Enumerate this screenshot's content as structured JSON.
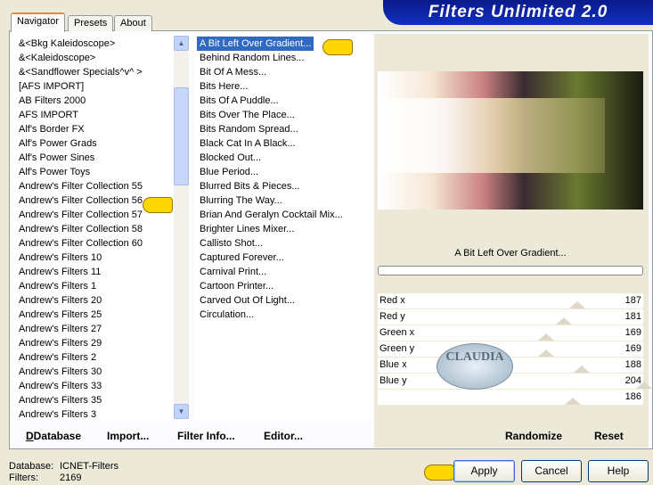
{
  "banner": {
    "title": "Filters Unlimited 2.0"
  },
  "tabs": [
    {
      "label": "Navigator"
    },
    {
      "label": "Presets"
    },
    {
      "label": "About"
    }
  ],
  "categories": [
    "&<Bkg Kaleidoscope>",
    "&<Kaleidoscope>",
    "&<Sandflower Specials^v^ >",
    "[AFS IMPORT]",
    "AB Filters 2000",
    "AFS IMPORT",
    "Alf's Border FX",
    "Alf's Power Grads",
    "Alf's Power Sines",
    "Alf's Power Toys",
    "Andrew's Filter Collection 55",
    "Andrew's Filter Collection 56",
    "Andrew's Filter Collection 57",
    "Andrew's Filter Collection 58",
    "Andrew's Filter Collection 60",
    "Andrew's Filters 10",
    "Andrew's Filters 11",
    "Andrew's Filters 1",
    "Andrew's Filters 20",
    "Andrew's Filters 25",
    "Andrew's Filters 27",
    "Andrew's Filters 29",
    "Andrew's Filters 2",
    "Andrew's Filters 30",
    "Andrew's Filters 33",
    "Andrew's Filters 35",
    "Andrew's Filters 3"
  ],
  "selected_category": "Andrew's Filter Collection 56",
  "filters": [
    "A Bit Left Over Gradient...",
    "Behind Random Lines...",
    "Bit Of A Mess...",
    "Bits Here...",
    "Bits Of A Puddle...",
    "Bits Over The Place...",
    "Bits Random Spread...",
    "Black Cat In A Black...",
    "Blocked Out...",
    "Blue Period...",
    "Blurred Bits & Pieces...",
    "Blurring The Way...",
    "Brian And Geralyn Cocktail Mix...",
    "Brighter Lines Mixer...",
    "Callisto Shot...",
    "Captured Forever...",
    "Carnival Print...",
    "Cartoon Printer...",
    "Carved Out Of Light...",
    "Circulation..."
  ],
  "selected_filter": "A Bit Left Over Gradient...",
  "preview_label": "A Bit Left Over Gradient...",
  "progress": 0,
  "sliders": [
    {
      "label": "Red x",
      "value": "187"
    },
    {
      "label": "Red y",
      "value": "181"
    },
    {
      "label": "Green x",
      "value": "169"
    },
    {
      "label": "Green y",
      "value": "169"
    },
    {
      "label": "Blue x",
      "value": "188"
    },
    {
      "label": "Blue y",
      "value": "204"
    },
    {
      "label": "",
      "value": "186"
    }
  ],
  "bottom": {
    "database": "Database",
    "import": "Import...",
    "filter_info": "Filter Info...",
    "editor": "Editor...",
    "randomize": "Randomize",
    "reset": "Reset"
  },
  "status": {
    "database_label": "Database:",
    "database_value": "ICNET-Filters",
    "filters_label": "Filters:",
    "filters_value": "2169"
  },
  "buttons": {
    "apply": "Apply",
    "cancel": "Cancel",
    "help": "Help"
  },
  "watermark": "CLAUDIA 2012"
}
